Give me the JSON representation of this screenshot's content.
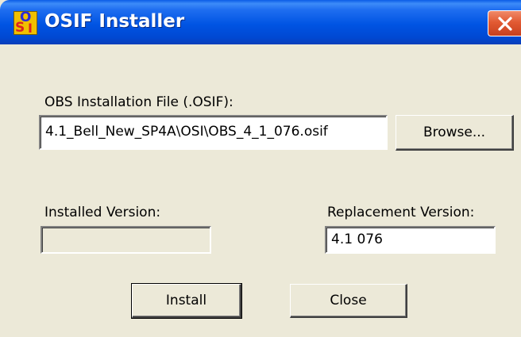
{
  "window": {
    "title": "OSIF Installer",
    "icon": "osif-app-icon",
    "close_icon": "close-icon",
    "close_color": "#e25a33"
  },
  "file": {
    "label": "OBS Installation File (.OSIF):",
    "value": "4.1_Bell_New_SP4A\\OSI\\OBS_4_1_076.osif",
    "browse_label": "Browse..."
  },
  "installed": {
    "label": "Installed Version:",
    "value": ""
  },
  "replacement": {
    "label": "Replacement Version:",
    "value": "4.1 076"
  },
  "actions": {
    "install_label": "Install",
    "close_label": "Close"
  }
}
